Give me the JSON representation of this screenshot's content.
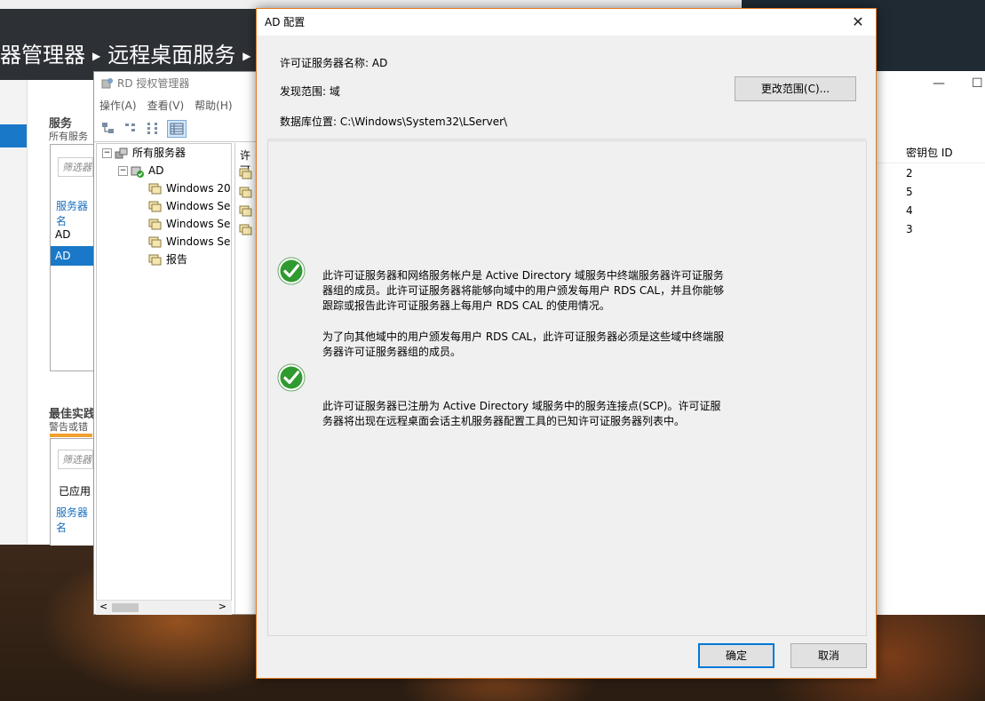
{
  "server_manager": {
    "breadcrumb": [
      "器管理器",
      "远程桌面服务"
    ],
    "services_title": "服务",
    "services_sub": "所有服务",
    "filter_placeholder": "筛选器",
    "server_col": "服务器名",
    "rows": [
      "AD",
      "AD"
    ],
    "bpa_title": "最佳实践",
    "bpa_sub": "警告或错",
    "bpa_filter": "筛选器",
    "bpa_applied": "已应用",
    "bpa_server_col": "服务器名"
  },
  "rd_manager": {
    "title": "RD 授权管理器",
    "menu": [
      "操作(A)",
      "查看(V)",
      "帮助(H)"
    ],
    "tree_root": "所有服务器",
    "tree_server": "AD",
    "tree_children": [
      "Windows 20",
      "Windows Se",
      "Windows Se",
      "Windows Se",
      "报告"
    ],
    "list_header": "许可"
  },
  "right_window": {
    "col_header": "密钥包 ID",
    "values": [
      "2",
      "5",
      "4",
      "3"
    ]
  },
  "dialog": {
    "title": "AD 配置",
    "server_name_label": "许可证服务器名称: AD",
    "discovery_label": "发现范围: 域",
    "db_label": "数据库位置: C:\\Windows\\System32\\LServer\\",
    "change_scope_button": "更改范围(C)...",
    "msg1_p1": "此许可证服务器和网络服务帐户是 Active Directory 域服务中终端服务器许可证服务器组的成员。此许可证服务器将能够向域中的用户颁发每用户 RDS CAL，并且你能够跟踪或报告此许可证服务器上每用户 RDS CAL 的使用情况。",
    "msg1_p2": "为了向其他域中的用户颁发每用户 RDS CAL，此许可证服务器必须是这些域中终端服务器许可证服务器组的成员。",
    "msg2": "此许可证服务器已注册为 Active Directory 域服务中的服务连接点(SCP)。许可证服务器将出现在远程桌面会话主机服务器配置工具的已知许可证服务器列表中。",
    "ok_button": "确定",
    "cancel_button": "取消"
  }
}
